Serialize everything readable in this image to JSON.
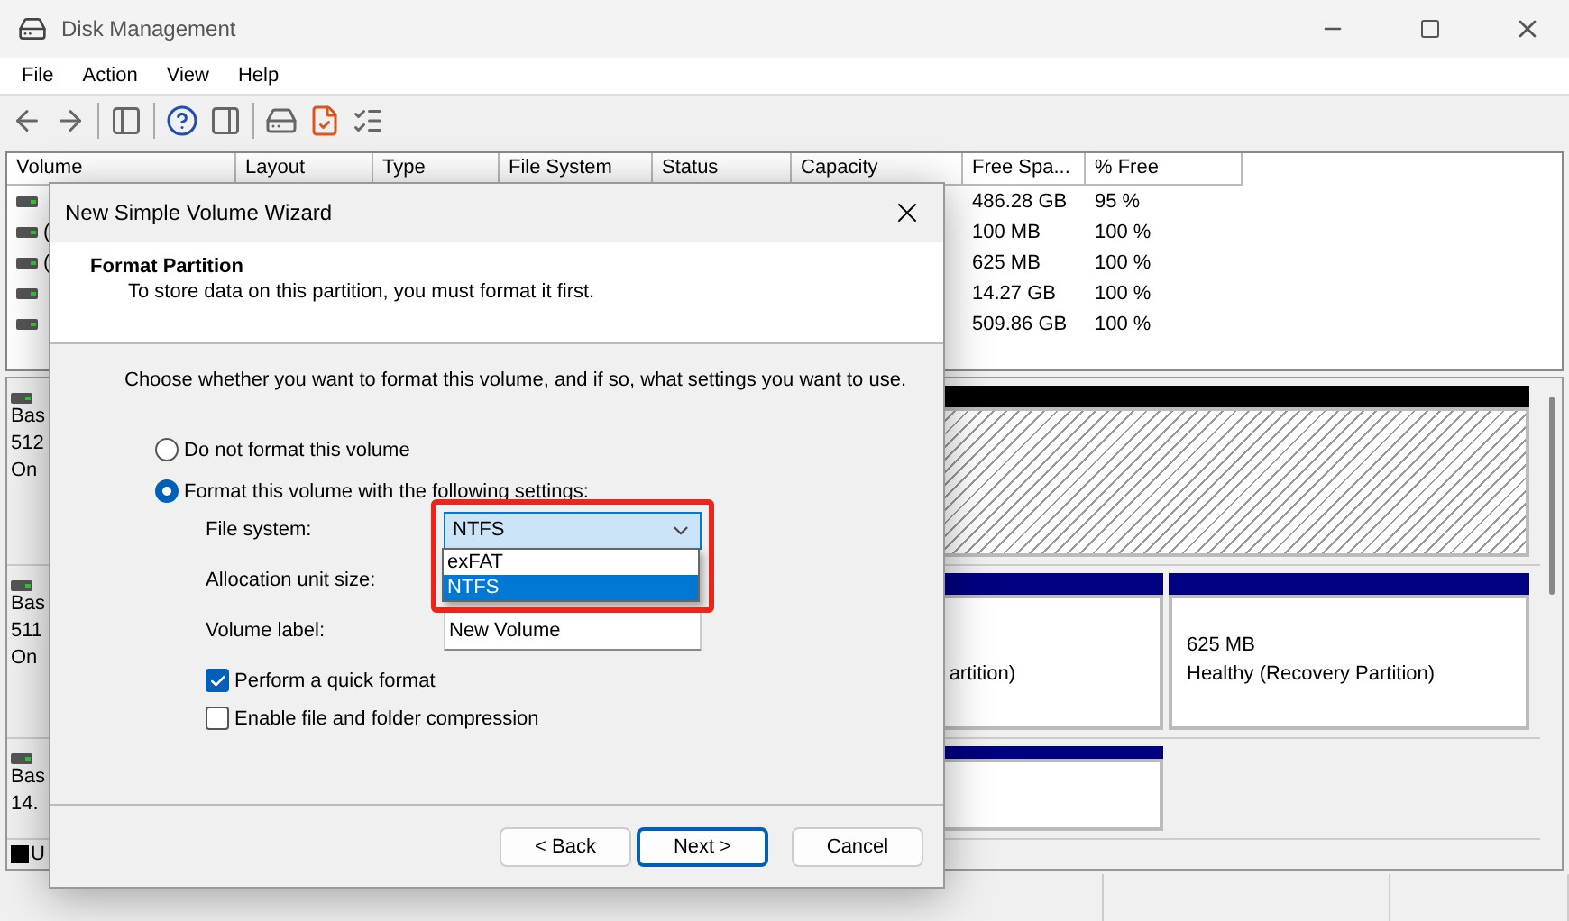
{
  "window": {
    "title": "Disk Management"
  },
  "menu": [
    "File",
    "Action",
    "View",
    "Help"
  ],
  "volume_table": {
    "columns": [
      "Volume",
      "Layout",
      "Type",
      "File System",
      "Status",
      "Capacity",
      "Free Spa...",
      "% Free"
    ],
    "rows": [
      {
        "free_space": "486.28 GB",
        "percent_free": "95 %"
      },
      {
        "volume": "(",
        "free_space": "100 MB",
        "percent_free": "100 %"
      },
      {
        "volume": "(",
        "free_space": "625 MB",
        "percent_free": "100 %"
      },
      {
        "free_space": "14.27 GB",
        "percent_free": "100 %"
      },
      {
        "free_space": "509.86 GB",
        "percent_free": "100 %"
      }
    ]
  },
  "disks": [
    {
      "lines": [
        "Bas",
        "512",
        "On"
      ],
      "partitions": [
        {
          "color": "#000000",
          "selected": true
        }
      ]
    },
    {
      "lines": [
        "Bas",
        "511",
        "On"
      ],
      "partitions": [
        {
          "color": "#000080",
          "selected": false,
          "lines": [
            "artition)"
          ]
        },
        {
          "color": "#000080",
          "selected": false,
          "lines": [
            "625 MB",
            "Healthy (Recovery Partition)"
          ]
        }
      ]
    },
    {
      "lines": [
        "Bas",
        "14."
      ],
      "partitions": [
        {
          "color": "#000080",
          "selected": false
        }
      ]
    }
  ],
  "legend": [
    {
      "color": "#000000",
      "label": "U"
    }
  ],
  "dialog": {
    "title": "New Simple Volume Wizard",
    "heading": "Format Partition",
    "subtitle": "To store data on this partition, you must format it first.",
    "instruction": "Choose whether you want to format this volume, and if so, what settings you want to use.",
    "radios": [
      {
        "label": "Do not format this volume",
        "selected": false
      },
      {
        "label": "Format this volume with the following settings:",
        "selected": true
      }
    ],
    "file_system": {
      "label": "File system:",
      "value": "NTFS",
      "expanded": true,
      "highlighted": true,
      "options": [
        {
          "label": "exFAT",
          "selected": false
        },
        {
          "label": "NTFS",
          "selected": true
        }
      ]
    },
    "allocation_unit_size": {
      "label": "Allocation unit size:"
    },
    "volume_label": {
      "label": "Volume label:",
      "value": "New Volume"
    },
    "checkboxes": [
      {
        "label": "Perform a quick format",
        "checked": true
      },
      {
        "label": "Enable file and folder compression",
        "checked": false
      }
    ],
    "buttons": [
      {
        "label": "< Back",
        "default": false
      },
      {
        "label": "Next >",
        "default": true
      },
      {
        "label": "Cancel",
        "default": false
      }
    ]
  }
}
